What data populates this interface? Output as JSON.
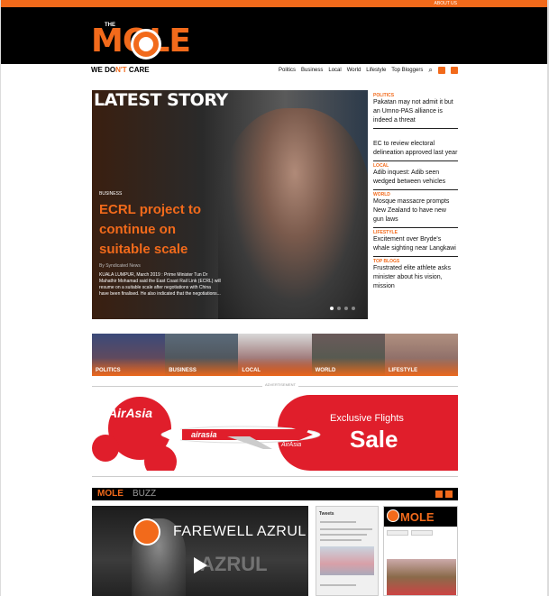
{
  "topbar": {
    "about": "ABOUT US"
  },
  "logo": {
    "the": "THE",
    "word": "MOLE",
    "tagline_pre": "WE DO",
    "tagline_mid": "N'T",
    "tagline_post": " CARE"
  },
  "nav": {
    "items": [
      "Politics",
      "Business",
      "Local",
      "World",
      "Lifestyle",
      "Top Bloggers"
    ],
    "search_icon": "search-icon",
    "social": [
      "twitter-icon",
      "facebook-icon"
    ]
  },
  "hero": {
    "heading": "LATEST STORY",
    "category": "BUSINESS",
    "title": "ECRL project to continue on suitable scale",
    "byline": "By Syndicated News",
    "excerpt": "KUALA LUMPUR, March 2019 : Prime Minister Tun Dr Mahathir Mohamad said the East Coast Rail Link (ECRL) will resume on a suitable scale after negotiations with China have been finalised. He also indicated that the negotiations..."
  },
  "side": [
    {
      "label": "Politics",
      "text": "Pakatan may not admit it but an Umno-PAS alliance is indeed a threat"
    },
    {
      "label": "",
      "text": "EC to review electoral delineation approved last year"
    },
    {
      "label": "Local",
      "text": "Adib inquest: Adib seen wedged between vehicles"
    },
    {
      "label": "World",
      "text": "Mosque massacre prompts New Zealand to have new gun laws"
    },
    {
      "label": "Lifestyle",
      "text": "Excitement over Bryde's whale sighting near Langkawi"
    },
    {
      "label": "Top Blogs",
      "text": "Frustrated elite athlete asks minister about his vision, mission"
    }
  ],
  "categories": [
    {
      "label": "POLITICS",
      "bg": "linear-gradient(180deg,#3b4a7a 0%,#7a4a4a 100%)"
    },
    {
      "label": "BUSINESS",
      "bg": "linear-gradient(180deg,#5a6a7a 0%,#4a4a4a 100%)"
    },
    {
      "label": "LOCAL",
      "bg": "linear-gradient(180deg,#d8d8d8 0%,#7a3a3a 100%)"
    },
    {
      "label": "WORLD",
      "bg": "linear-gradient(180deg,#6a5a5a 0%,#4a5a4a 100%)"
    },
    {
      "label": "LIFESTYLE",
      "bg": "linear-gradient(180deg,#b09080 0%,#7a5a5a 100%)"
    }
  ],
  "ad": {
    "label": "ADVERTISEMENT",
    "brand": "AirAsia",
    "line1": "Exclusive Flights",
    "line2": "Sale",
    "livery": "airasia",
    "tail": "AirAsia"
  },
  "buzz": {
    "title_a": "MOLE",
    "title_b": "BUZZ"
  },
  "video": {
    "title": "FAREWELL AZRUL",
    "bg_text": "AZRUL"
  },
  "tweets": {
    "header": "Tweets"
  },
  "fb": {
    "cover": "MOLE"
  },
  "colors": {
    "accent": "#f26a1b",
    "ad_red": "#e01e2b"
  }
}
